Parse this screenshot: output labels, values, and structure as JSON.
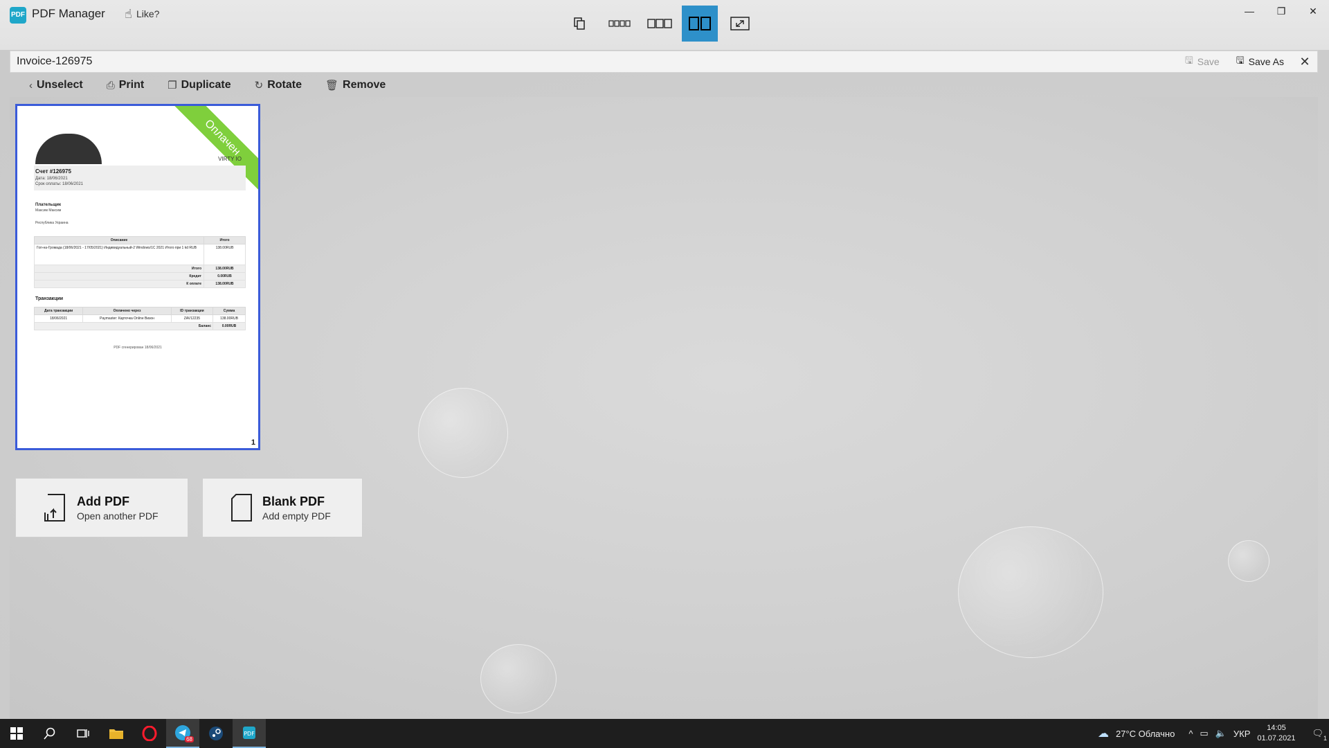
{
  "app": {
    "title": "PDF Manager",
    "like_label": "Like?",
    "logo_text": "PDF"
  },
  "view_buttons": [
    {
      "name": "single-page-view-button",
      "label": "❐"
    },
    {
      "name": "four-column-view-button",
      "label": "▭▭▭▭"
    },
    {
      "name": "three-column-view-button",
      "label": "▭▭▭"
    },
    {
      "name": "two-column-view-button",
      "label": "▭▭"
    },
    {
      "name": "fit-view-button",
      "label": "⤢"
    }
  ],
  "window_controls": {
    "minimize": "—",
    "restore": "❐",
    "close": "✕"
  },
  "document": {
    "name": "Invoice-126975",
    "save_label": "Save",
    "save_as_label": "Save As",
    "close_label": "✕"
  },
  "toolbar": {
    "unselect": "Unselect",
    "print": "Print",
    "duplicate": "Duplicate",
    "rotate": "Rotate",
    "remove": "Remove"
  },
  "page": {
    "number": "1",
    "status_ribbon": "Оплачен",
    "company": "VIRTY IO",
    "invoice_title": "Счет #126975",
    "date": "Дата: 18/06/2021",
    "due_date": "Срок оплаты: 18/06/2021",
    "payer_label": "Плательщик",
    "payer_name": "Максим Максим",
    "payer_address": "Республика Украина",
    "table_headers": [
      "Описание",
      "Итого"
    ],
    "table_row": [
      "Гоп-на-Громада (18/06/2021 - 17/05/2021) Индивидуальный-2 Windows/1С 2021 Итого при 1 kd RUB",
      "138.00RUB"
    ],
    "totals": [
      [
        "Итого",
        "138.00RUB"
      ],
      [
        "Кредит",
        "0.00RUB"
      ],
      [
        "К оплате",
        "138.00RUB"
      ]
    ],
    "transactions_title": "Транзакции",
    "transactions_headers": [
      "Дата транзакции",
      "Оплачено через",
      "ID транзакции",
      "Сумма"
    ],
    "transactions_row": [
      "18/06/2021",
      "Paymaster: Карточка Online Визон",
      "ZAV12235",
      "138.00RUB"
    ],
    "balance": [
      "Баланс",
      "0.00RUB"
    ],
    "footer": "PDF сгенерирован 18/06/2021"
  },
  "add_pdf": {
    "title": "Add PDF",
    "subtitle": "Open another PDF"
  },
  "blank_pdf": {
    "title": "Blank PDF",
    "subtitle": "Add empty PDF"
  },
  "taskbar": {
    "weather": "27°C Облачно",
    "language": "УКР",
    "time": "14:05",
    "date": "01.07.2021",
    "telegram_badge": "68",
    "notification_count": "1"
  },
  "colors": {
    "accent": "#2e90c9",
    "selection": "#3a5bd9",
    "paid": "#7fcf3c"
  }
}
